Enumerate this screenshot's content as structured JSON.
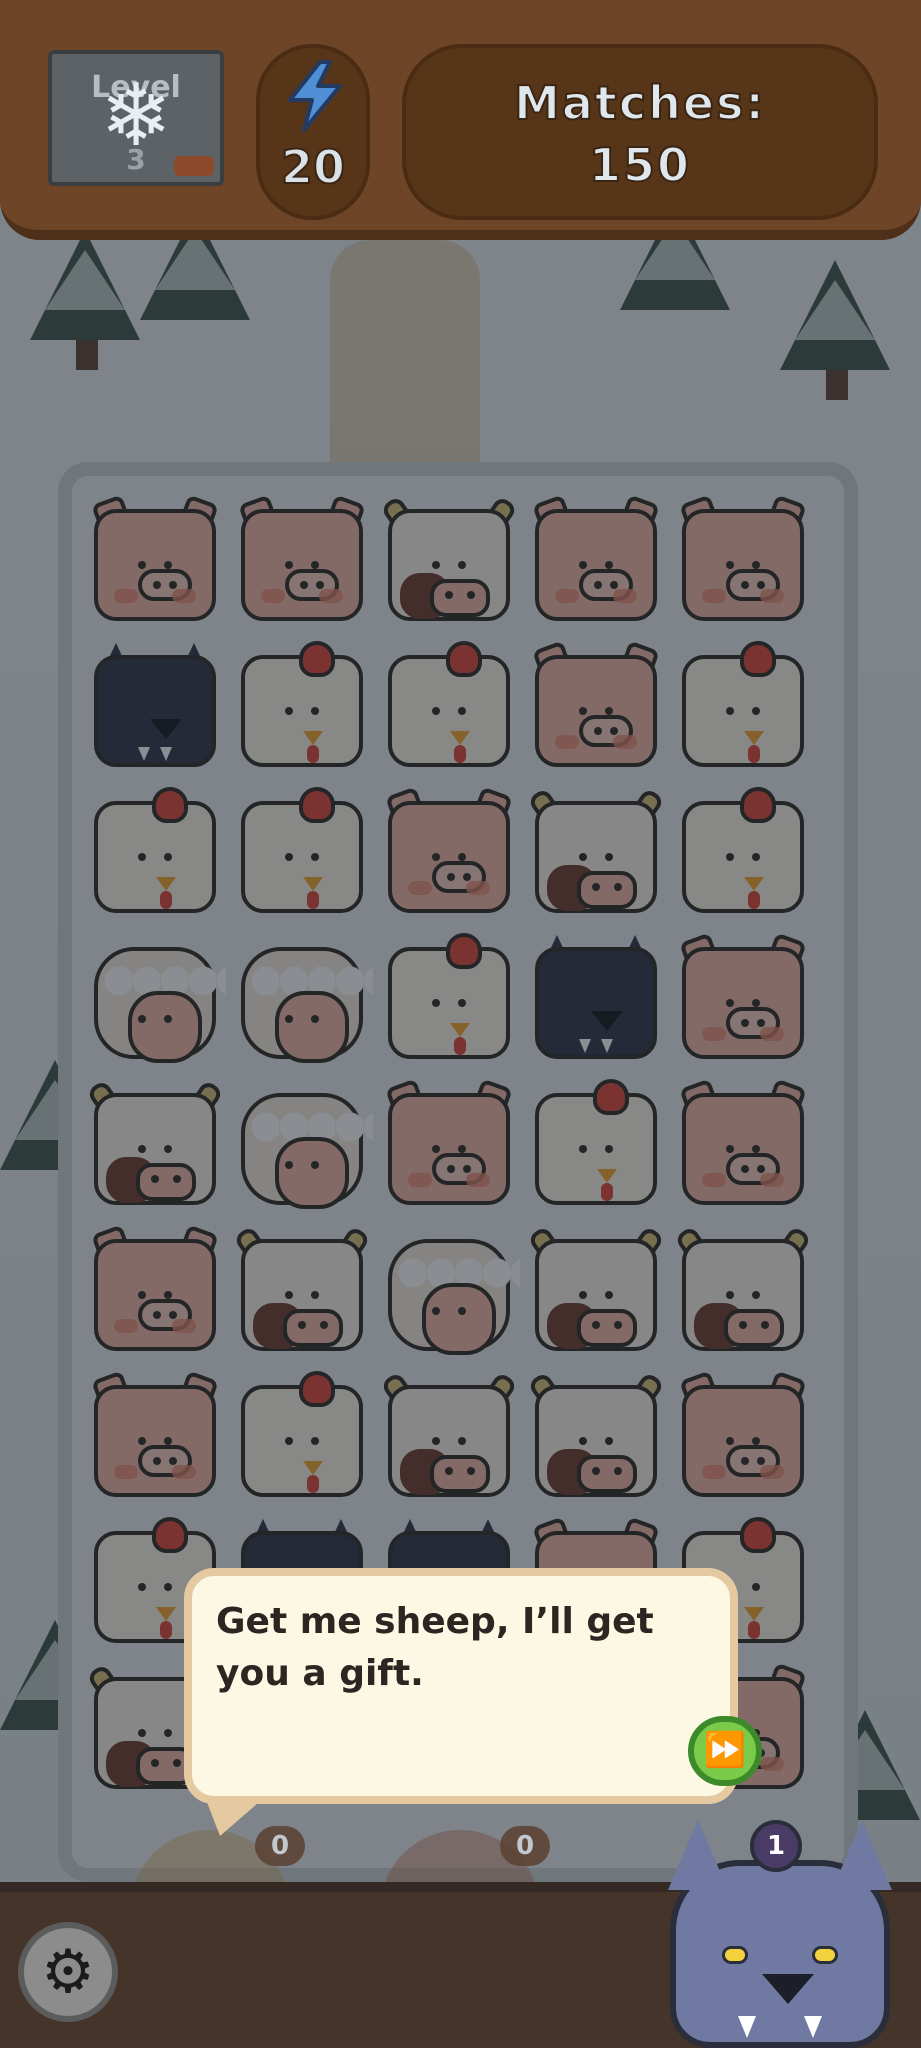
{
  "top_bar": {
    "level": {
      "label": "Level",
      "number": "3",
      "icon": "snowflake-icon"
    },
    "energy": {
      "icon": "lightning-icon",
      "value": "20"
    },
    "matches": {
      "label": "Matches:",
      "value": "150"
    }
  },
  "board": {
    "rows": [
      [
        "pig",
        "pig",
        "cow",
        "pig",
        "pig"
      ],
      [
        "wolf",
        "chicken",
        "chicken",
        "pig",
        "chicken"
      ],
      [
        "chicken",
        "chicken",
        "pig",
        "cow",
        "chicken"
      ],
      [
        "sheep",
        "sheep",
        "chicken",
        "wolf",
        "pig"
      ],
      [
        "cow",
        "sheep",
        "pig",
        "chicken",
        "pig"
      ],
      [
        "pig",
        "cow",
        "sheep",
        "cow",
        "cow"
      ],
      [
        "pig",
        "chicken",
        "cow",
        "cow",
        "pig"
      ],
      [
        "chicken",
        "wolf",
        "wolf",
        "pig",
        "chicken"
      ],
      [
        "cow",
        "",
        "",
        "",
        "pig"
      ]
    ]
  },
  "dialog": {
    "text": "Get me sheep, I’ll get you a gift.",
    "skip_icon": "fast-forward-icon"
  },
  "bottom_bar": {
    "settings_icon": "gear-icon",
    "boosters": [
      {
        "icon": "carrot-icon",
        "count": "0"
      },
      {
        "icon": "apple-icon",
        "count": "0"
      }
    ],
    "character": {
      "name_icon": "wolf-icon",
      "badge": "1"
    }
  },
  "colors": {
    "wood": "#6e4527",
    "dialog_bg": "#fdf8e4",
    "dialog_border": "#e4c9a1",
    "skip_green": "#7acb4a"
  }
}
